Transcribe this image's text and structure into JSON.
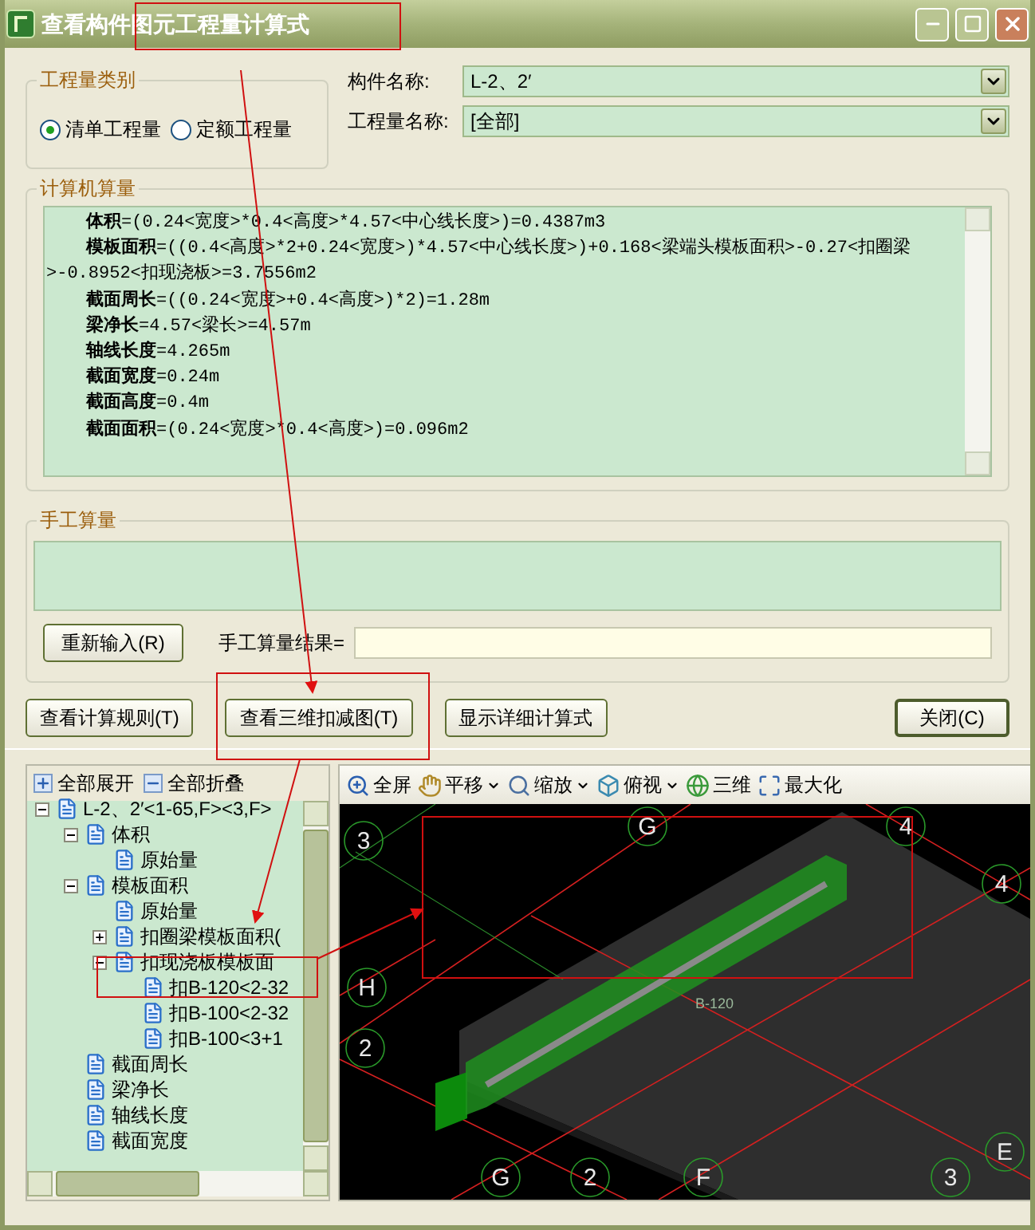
{
  "window": {
    "title": "查看构件图元工程量计算式"
  },
  "quantity_type": {
    "label": "工程量类别",
    "options": [
      {
        "label": "清单工程量",
        "selected": true
      },
      {
        "label": "定额工程量",
        "selected": false
      }
    ]
  },
  "fields": [
    {
      "label": "构件名称:",
      "value": "L-2、2′"
    },
    {
      "label": "工程量名称:",
      "value": "[全部]"
    }
  ],
  "computer_calc": {
    "label": "计算机算量",
    "lines": [
      "**体积**=(0.24<宽度>*0.4<高度>*4.57<中心线长度>)=0.4387m3",
      "**模板面积**=((0.4<高度>*2+0.24<宽度>)*4.57<中心线长度>)+0.168<梁端头模板面积>-0.27<扣圈梁>-0.8952<扣现浇板>=3.7556m2",
      "**截面周长**=((0.24<宽度>+0.4<高度>)*2)=1.28m",
      "**梁净长**=4.57<梁长>=4.57m",
      "**轴线长度**=4.265m",
      "**截面宽度**=0.24m",
      "**截面高度**=0.4m",
      "**截面面积**=(0.24<宽度>*0.4<高度>)=0.096m2"
    ]
  },
  "manual_calc": {
    "label": "手工算量",
    "reenter_button": "重新输入(R)",
    "result_label": "手工算量结果="
  },
  "buttons": [
    {
      "label": "查看计算规则(T)",
      "default": false
    },
    {
      "label": "查看三维扣减图(T)",
      "default": false
    },
    {
      "label": "显示详细计算式",
      "default": false
    },
    {
      "label": "关闭(C)",
      "default": true
    }
  ],
  "tree_toolbar": [
    {
      "kind": "expand",
      "label": "全部展开"
    },
    {
      "kind": "collapse",
      "label": "全部折叠"
    }
  ],
  "tree": [
    {
      "label": "L-2、2′<1-65,F><3,F>",
      "expanded": true,
      "children": [
        {
          "label": "体积",
          "expanded": true,
          "children": [
            {
              "label": "原始量"
            }
          ]
        },
        {
          "label": "模板面积",
          "expanded": true,
          "children": [
            {
              "label": "原始量"
            },
            {
              "label": "扣圈梁模板面积(",
              "expanded": false
            },
            {
              "label": "扣现浇板模板面",
              "expanded": true,
              "children": [
                {
                  "label": "扣B-120<2-32"
                },
                {
                  "label": "扣B-100<2-32"
                },
                {
                  "label": "扣B-100<3+1"
                }
              ]
            }
          ]
        },
        {
          "label": "截面周长"
        },
        {
          "label": "梁净长"
        },
        {
          "label": "轴线长度"
        },
        {
          "label": "截面宽度"
        }
      ]
    }
  ],
  "view_toolbar": [
    {
      "kind": "fullscreen",
      "label": "全屏",
      "dropdown": false
    },
    {
      "kind": "pan",
      "label": "平移",
      "dropdown": true
    },
    {
      "kind": "zoom",
      "label": "缩放",
      "dropdown": true
    },
    {
      "kind": "view",
      "label": "俯视",
      "dropdown": true
    },
    {
      "kind": "orbit",
      "label": "三维",
      "dropdown": false
    },
    {
      "kind": "maximize",
      "label": "最大化",
      "dropdown": false
    }
  ],
  "view": {
    "axis_labels": [
      "3",
      "G",
      "4",
      "4",
      "H",
      "2",
      "G",
      "2",
      "F",
      "3",
      "E"
    ],
    "slab_label": "B-120"
  }
}
